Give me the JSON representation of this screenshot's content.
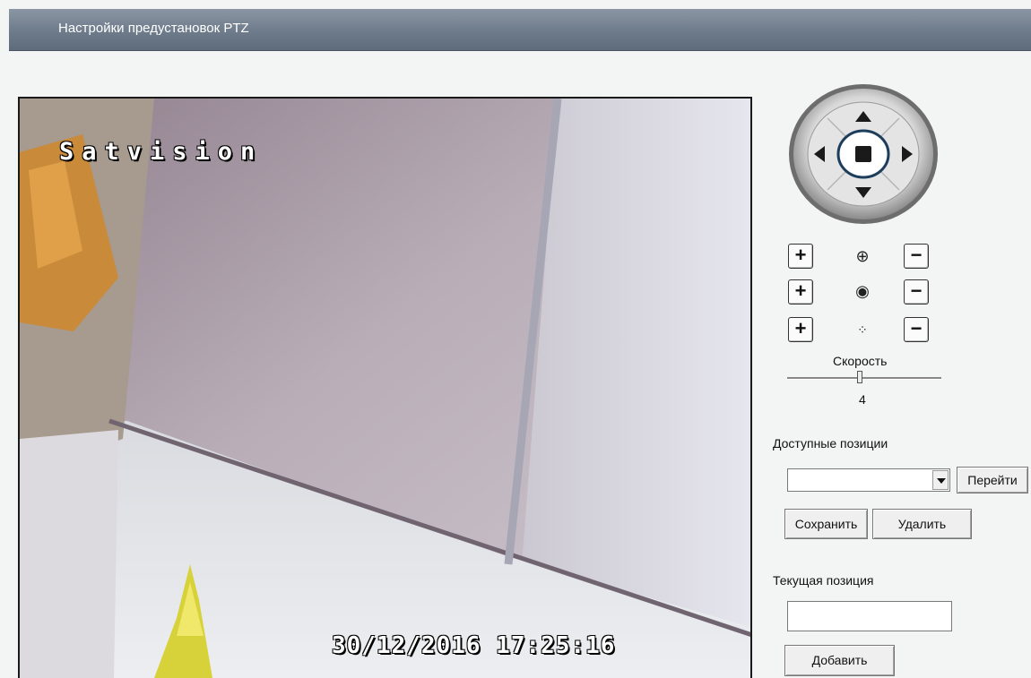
{
  "header": {
    "title": "Настройки предустановок PTZ"
  },
  "video": {
    "osd_name": "Satvision",
    "osd_datetime": "30/12/2016 17:25:16"
  },
  "ptz": {
    "rows": [
      {
        "plus": "+",
        "minus": "−",
        "icon": "⊕"
      },
      {
        "plus": "+",
        "minus": "−",
        "icon": "◉"
      },
      {
        "plus": "+",
        "minus": "−",
        "icon": "⁘"
      }
    ],
    "speed_label": "Скорость",
    "speed_value": "4"
  },
  "presets": {
    "available_label": "Доступные позиции",
    "selected": "",
    "goto_button": "Перейти",
    "save_button": "Сохранить",
    "delete_button": "Удалить",
    "current_label": "Текущая позиция",
    "current_value": "",
    "add_button": "Добавить"
  },
  "colors": {
    "titlebar": "#6e7b8a",
    "background": "#f3f4f4"
  }
}
